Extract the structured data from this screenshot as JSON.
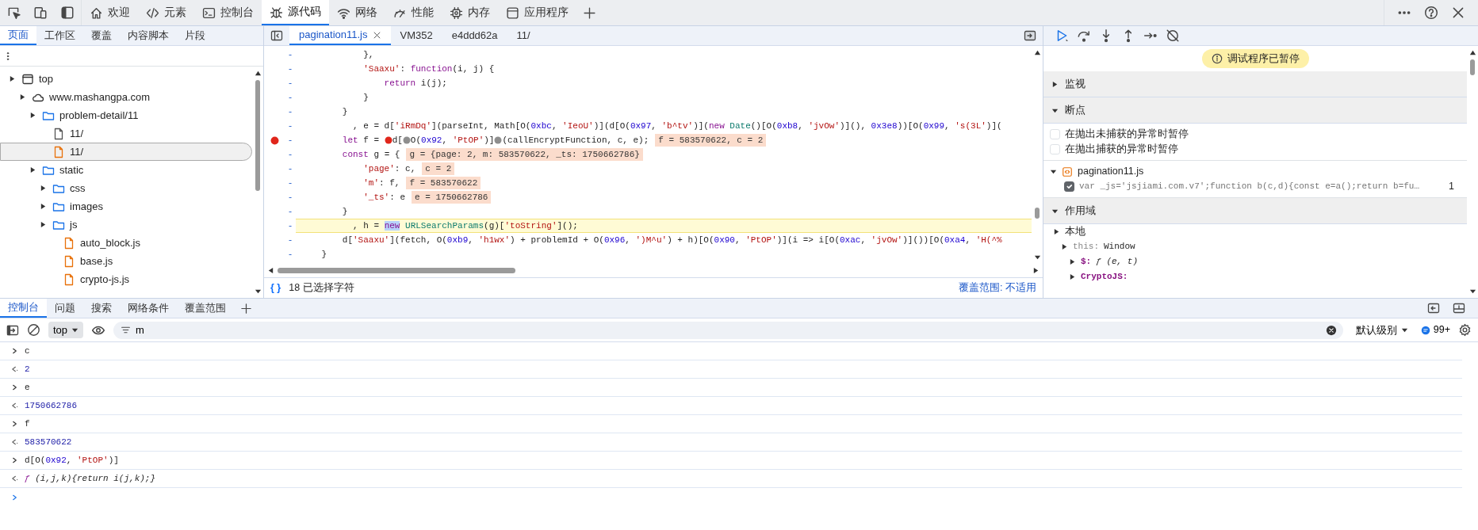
{
  "main_tabs": [
    {
      "label": "欢迎",
      "selected": false
    },
    {
      "label": "元素",
      "selected": false
    },
    {
      "label": "控制台",
      "selected": false
    },
    {
      "label": "源代码",
      "selected": true
    },
    {
      "label": "网络",
      "selected": false
    },
    {
      "label": "性能",
      "selected": false
    },
    {
      "label": "内存",
      "selected": false
    },
    {
      "label": "应用程序",
      "selected": false
    }
  ],
  "navigator": {
    "tabs": [
      {
        "label": "页面",
        "selected": true
      },
      {
        "label": "工作区",
        "selected": false
      },
      {
        "label": "覆盖",
        "selected": false
      },
      {
        "label": "内容脚本",
        "selected": false
      },
      {
        "label": "片段",
        "selected": false
      }
    ],
    "tree": [
      {
        "label": "top",
        "kind": "frame",
        "selected": false,
        "children": [
          {
            "label": "www.mashangpa.com",
            "kind": "domain",
            "selected": false,
            "children": [
              {
                "label": "problem-detail/11",
                "kind": "folder",
                "selected": false,
                "children": [
                  {
                    "label": "11/",
                    "kind": "document",
                    "selected": false
                  },
                  {
                    "label": "11/",
                    "kind": "script",
                    "selected": true
                  }
                ]
              },
              {
                "label": "static",
                "kind": "folder",
                "selected": false,
                "children": [
                  {
                    "label": "css",
                    "kind": "folder",
                    "selected": false
                  },
                  {
                    "label": "images",
                    "kind": "folder",
                    "selected": false
                  },
                  {
                    "label": "js",
                    "kind": "folder",
                    "selected": false,
                    "children": [
                      {
                        "label": "auto_block.js",
                        "kind": "script",
                        "selected": false
                      },
                      {
                        "label": "base.js",
                        "kind": "script",
                        "selected": false
                      },
                      {
                        "label": "crypto-js.js",
                        "kind": "script",
                        "selected": false
                      }
                    ]
                  }
                ]
              }
            ]
          }
        ]
      }
    ]
  },
  "editor": {
    "tabs": [
      {
        "label": "pagination11.js",
        "selected": true
      },
      {
        "label": "VM352",
        "selected": false
      },
      {
        "label": "e4ddd62a",
        "selected": false
      },
      {
        "label": "11/",
        "selected": false
      }
    ],
    "lines": [
      {
        "gutter": "-",
        "breakpoint": false,
        "paused": false,
        "tokens": [
          {
            "kind": "plain",
            "text": "            },"
          }
        ]
      },
      {
        "gutter": "-",
        "breakpoint": false,
        "paused": false,
        "tokens": [
          {
            "kind": "string",
            "text": "            'Saaxu'"
          },
          {
            "kind": "plain",
            "text": ": "
          },
          {
            "kind": "keyword",
            "text": "function"
          },
          {
            "kind": "plain",
            "text": "(i, j) {"
          }
        ]
      },
      {
        "gutter": "-",
        "breakpoint": false,
        "paused": false,
        "tokens": [
          {
            "kind": "keyword",
            "text": "                return"
          },
          {
            "kind": "plain",
            "text": " i(j);"
          }
        ]
      },
      {
        "gutter": "-",
        "breakpoint": false,
        "paused": false,
        "tokens": [
          {
            "kind": "plain",
            "text": "            }"
          }
        ]
      },
      {
        "gutter": "-",
        "breakpoint": false,
        "paused": false,
        "tokens": [
          {
            "kind": "plain",
            "text": "        }"
          }
        ]
      },
      {
        "gutter": "-",
        "breakpoint": false,
        "paused": false,
        "tokens": [
          {
            "kind": "plain",
            "text": "          , e = d["
          },
          {
            "kind": "string",
            "text": "'iRmDq'"
          },
          {
            "kind": "plain",
            "text": "](parseInt, Math[O("
          },
          {
            "kind": "number",
            "text": "0xbc"
          },
          {
            "kind": "plain",
            "text": ", "
          },
          {
            "kind": "string",
            "text": "'IeoU'"
          },
          {
            "kind": "plain",
            "text": ")](d[O("
          },
          {
            "kind": "number",
            "text": "0x97"
          },
          {
            "kind": "plain",
            "text": ", "
          },
          {
            "kind": "string",
            "text": "'b^tv'"
          },
          {
            "kind": "plain",
            "text": ")]("
          },
          {
            "kind": "keyword",
            "text": "new"
          },
          {
            "kind": "type",
            "text": " Date"
          },
          {
            "kind": "plain",
            "text": "()[O("
          },
          {
            "kind": "number",
            "text": "0xb8"
          },
          {
            "kind": "plain",
            "text": ", "
          },
          {
            "kind": "string",
            "text": "'jvOw'"
          },
          {
            "kind": "plain",
            "text": ")](), "
          },
          {
            "kind": "number",
            "text": "0x3e8"
          },
          {
            "kind": "plain",
            "text": "))[O("
          },
          {
            "kind": "number",
            "text": "0x99"
          },
          {
            "kind": "plain",
            "text": ", "
          },
          {
            "kind": "string",
            "text": "'s(3L'"
          },
          {
            "kind": "plain",
            "text": ")]("
          }
        ]
      },
      {
        "gutter": "-",
        "breakpoint": true,
        "paused": false,
        "tokens": [
          {
            "kind": "keyword",
            "text": "        let"
          },
          {
            "kind": "plain",
            "text": " f = "
          },
          {
            "kind": "breakpoint",
            "active": true
          },
          {
            "kind": "plain",
            "text": "d["
          },
          {
            "kind": "breakpoint",
            "active": false
          },
          {
            "kind": "plain",
            "text": "O("
          },
          {
            "kind": "number",
            "text": "0x92"
          },
          {
            "kind": "plain",
            "text": ", "
          },
          {
            "kind": "string",
            "text": "'PtOP'"
          },
          {
            "kind": "plain",
            "text": ")]"
          },
          {
            "kind": "breakpoint",
            "active": false
          },
          {
            "kind": "plain",
            "text": "(callEncryptFunction, c, e);"
          }
        ],
        "values": [
          "f = 583570622, c = 2"
        ]
      },
      {
        "gutter": "-",
        "breakpoint": false,
        "paused": false,
        "tokens": [
          {
            "kind": "keyword",
            "text": "        const"
          },
          {
            "kind": "plain",
            "text": " g = {"
          }
        ],
        "values": [
          "g = {page: 2, m: 583570622, _ts: 1750662786}"
        ]
      },
      {
        "gutter": "-",
        "breakpoint": false,
        "paused": false,
        "tokens": [
          {
            "kind": "string",
            "text": "            'page'"
          },
          {
            "kind": "plain",
            "text": ": c,"
          }
        ],
        "values": [
          "c = 2"
        ]
      },
      {
        "gutter": "-",
        "breakpoint": false,
        "paused": false,
        "tokens": [
          {
            "kind": "string",
            "text": "            'm'"
          },
          {
            "kind": "plain",
            "text": ": f,"
          }
        ],
        "values": [
          "f = 583570622"
        ]
      },
      {
        "gutter": "-",
        "breakpoint": false,
        "paused": false,
        "tokens": [
          {
            "kind": "string",
            "text": "            '_ts'"
          },
          {
            "kind": "plain",
            "text": ": e"
          }
        ],
        "values": [
          "e = 1750662786"
        ]
      },
      {
        "gutter": "-",
        "breakpoint": false,
        "paused": false,
        "tokens": [
          {
            "kind": "plain",
            "text": "        }"
          }
        ]
      },
      {
        "gutter": "-",
        "breakpoint": false,
        "paused": true,
        "tokens": [
          {
            "kind": "plain",
            "text": "          , h = "
          },
          {
            "kind": "selected",
            "text": "new"
          },
          {
            "kind": "type",
            "text": " URLSearchParams"
          },
          {
            "kind": "plain",
            "text": "(g)["
          },
          {
            "kind": "string",
            "text": "'toString'"
          },
          {
            "kind": "plain",
            "text": "]();"
          }
        ]
      },
      {
        "gutter": "-",
        "breakpoint": false,
        "paused": false,
        "tokens": [
          {
            "kind": "plain",
            "text": "        d["
          },
          {
            "kind": "string",
            "text": "'Saaxu'"
          },
          {
            "kind": "plain",
            "text": "](fetch, O("
          },
          {
            "kind": "number",
            "text": "0xb9"
          },
          {
            "kind": "plain",
            "text": ", "
          },
          {
            "kind": "string",
            "text": "'h1wx'"
          },
          {
            "kind": "plain",
            "text": ") + problemId + O("
          },
          {
            "kind": "number",
            "text": "0x96"
          },
          {
            "kind": "plain",
            "text": ", "
          },
          {
            "kind": "string",
            "text": "')M^u'"
          },
          {
            "kind": "plain",
            "text": ") + h)[O("
          },
          {
            "kind": "number",
            "text": "0x90"
          },
          {
            "kind": "plain",
            "text": ", "
          },
          {
            "kind": "string",
            "text": "'PtOP'"
          },
          {
            "kind": "plain",
            "text": ")](i => i[O("
          },
          {
            "kind": "number",
            "text": "0xac"
          },
          {
            "kind": "plain",
            "text": ", "
          },
          {
            "kind": "string",
            "text": "'jvOw'"
          },
          {
            "kind": "plain",
            "text": ")]())[O("
          },
          {
            "kind": "number",
            "text": "0xa4"
          },
          {
            "kind": "plain",
            "text": ", "
          },
          {
            "kind": "string",
            "text": "'H(^%"
          }
        ]
      },
      {
        "gutter": "-",
        "breakpoint": false,
        "paused": false,
        "tokens": [
          {
            "kind": "plain",
            "text": "    }"
          }
        ]
      }
    ],
    "format_button": "{ }",
    "selection": "18 已选择字符",
    "coverage": "覆盖范围: 不适用"
  },
  "debugger": {
    "banner": "调试程序已暂停",
    "sections": [
      {
        "title": "监视",
        "expanded": false
      },
      {
        "kind": "breakpoints",
        "title": "断点",
        "expanded": true,
        "options": [
          {
            "label": "在抛出未捕获的异常时暂停",
            "checked": false
          },
          {
            "label": "在抛出捕获的异常时暂停",
            "checked": false
          }
        ],
        "files": [
          {
            "name": "pagination11.js",
            "expanded": true,
            "entries": [
              {
                "code": "var _js='jsjiami.com.v7';function b(c,d){const e=a();return b=fu…",
                "line": "1",
                "checked": true
              }
            ]
          }
        ]
      },
      {
        "kind": "scope",
        "title": "作用域",
        "expanded": true,
        "items": [
          {
            "label": "本地",
            "kind": "group",
            "children": [
              {
                "label": "this:",
                "value": "Window",
                "kind": "receiver",
                "children": [
                  {
                    "label": "$:",
                    "value": "ƒ (e, t)",
                    "kind": "property"
                  },
                  {
                    "label": "CryptoJS:",
                    "kind": "property"
                  }
                ]
              }
            ]
          }
        ]
      }
    ]
  },
  "console": {
    "tabs": [
      {
        "label": "控制台",
        "selected": true
      },
      {
        "label": "问题",
        "selected": false
      },
      {
        "label": "搜索",
        "selected": false
      },
      {
        "label": "网络条件",
        "selected": false
      },
      {
        "label": "覆盖范围",
        "selected": false
      }
    ],
    "context": "top",
    "filter": "m",
    "level": "默认级别",
    "issues": "99+",
    "messages": [
      {
        "kind": "input",
        "tokens": [
          {
            "kind": "plain",
            "text": "c"
          }
        ]
      },
      {
        "kind": "result",
        "tokens": [
          {
            "kind": "number",
            "text": "2"
          }
        ]
      },
      {
        "kind": "input",
        "tokens": [
          {
            "kind": "plain",
            "text": "e"
          }
        ]
      },
      {
        "kind": "result",
        "tokens": [
          {
            "kind": "number",
            "text": "1750662786"
          }
        ]
      },
      {
        "kind": "input",
        "tokens": [
          {
            "kind": "plain",
            "text": "f"
          }
        ]
      },
      {
        "kind": "result",
        "tokens": [
          {
            "kind": "number",
            "text": "583570622"
          }
        ]
      },
      {
        "kind": "input",
        "tokens": [
          {
            "kind": "plain",
            "text": "d[O("
          },
          {
            "kind": "number",
            "text": "0x92"
          },
          {
            "kind": "plain",
            "text": ", "
          },
          {
            "kind": "string",
            "text": "'PtOP'"
          },
          {
            "kind": "plain",
            "text": ")]"
          }
        ]
      },
      {
        "kind": "result",
        "tokens": [
          {
            "kind": "function",
            "text": "ƒ"
          },
          {
            "kind": "italic",
            "text": " (i,j,k){return i(j,k);}"
          }
        ]
      }
    ]
  }
}
